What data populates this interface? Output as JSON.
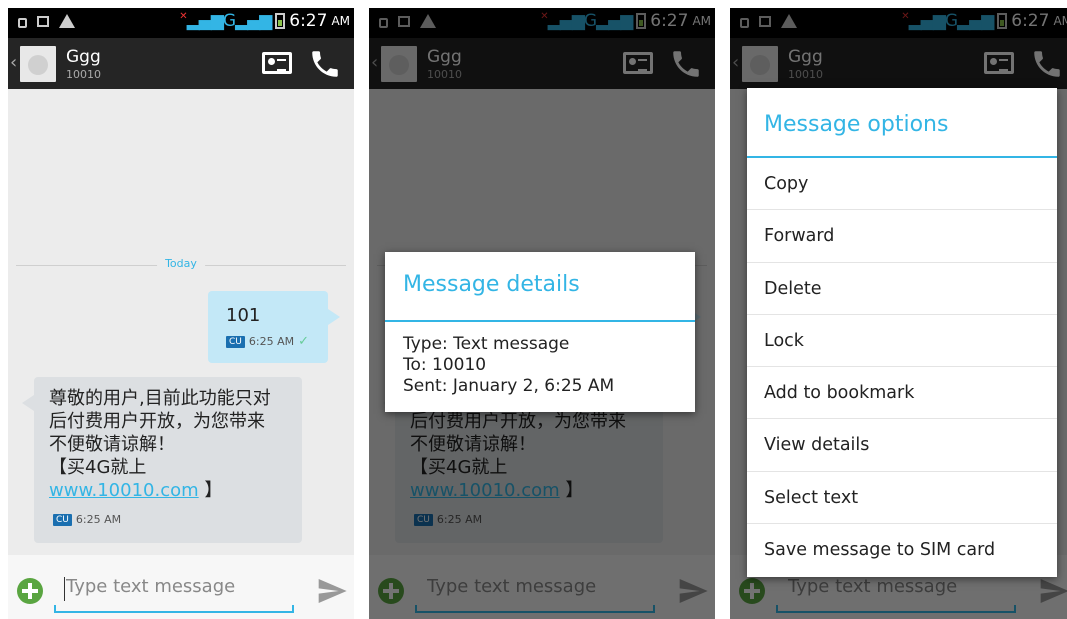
{
  "status": {
    "time": "6:27",
    "ampm": "AM",
    "network": "G"
  },
  "header": {
    "contact_name": "Ggg",
    "contact_number": "10010"
  },
  "conversation": {
    "date_divider": "Today",
    "outgoing": {
      "text": "101",
      "carrier": "CU",
      "time": "6:25 AM"
    },
    "incoming": {
      "line1": "尊敬的用户,目前此功能只对",
      "line2": "后付费用户开放，为您带来",
      "line3": "不便敬请谅解！",
      "line4": "【买4G就上",
      "link": "www.10010.com",
      "link_suffix": " 】",
      "carrier": "CU",
      "time": "6:25 AM"
    }
  },
  "compose": {
    "placeholder": "Type text message"
  },
  "details_dialog": {
    "title": "Message details",
    "type_line": "Type: Text message",
    "to_line": "To: 10010",
    "sent_line": "Sent: January 2, 6:25 AM"
  },
  "options_menu": {
    "title": "Message options",
    "items": [
      "Copy",
      "Forward",
      "Delete",
      "Lock",
      "Add to bookmark",
      "View details",
      "Select text",
      "Save message to SIM card"
    ]
  },
  "colors": {
    "accent": "#33b5e5",
    "outgoing_bubble": "#c3e8f7",
    "incoming_bubble": "#dcdfe2",
    "action_bar": "#252525"
  }
}
